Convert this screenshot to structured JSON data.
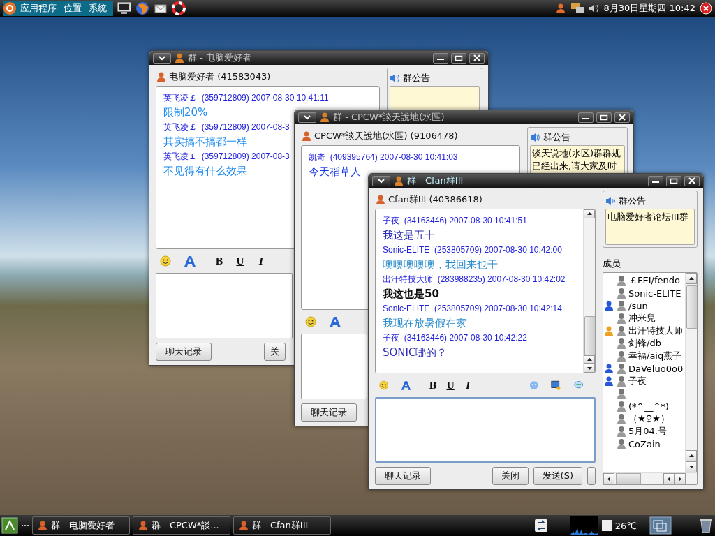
{
  "top_panel": {
    "menus": [
      {
        "label": "应用程序"
      },
      {
        "label": "位置"
      },
      {
        "label": "系统"
      }
    ],
    "clock": "8月30日星期四 10:42"
  },
  "windows": [
    {
      "title": "群 - 电脑爱好者",
      "active": false,
      "group": "电脑爱好者 (41583043)",
      "messages": [
        {
          "header": "英飞凌￡  (359712809) 2007-08-30 10:41:11",
          "text": "限制20%",
          "color": "#1e8cf0",
          "bold": false
        },
        {
          "header": "英飞凌￡  (359712809) 2007-08-3",
          "text": "其实搞不搞都一样",
          "color": "#1e8cf0",
          "bold": false
        },
        {
          "header": "英飞凌￡  (359712809) 2007-08-3",
          "text": "不见得有什么效果",
          "color": "#1e8cf0",
          "bold": false
        }
      ],
      "announcement": {
        "title": "群公告"
      },
      "format_buttons": [
        "B",
        "U",
        "I"
      ],
      "buttons": [
        "聊天记录",
        "关"
      ]
    },
    {
      "title": "群 - CPCW*談天說地(水區)",
      "active": false,
      "group": "CPCW*談天說地(水區) (9106478)",
      "messages": [
        {
          "header": "凯奇  (409395764) 2007-08-30 10:41:03",
          "text": "今天稻草人",
          "color": "#1a3ae8",
          "bold": false
        }
      ],
      "announcement": {
        "title": "群公告",
        "lines": [
          "谈天说地(水区)群群规",
          "已经出来,请大家及时"
        ]
      },
      "buttons": [
        "聊天记录"
      ]
    },
    {
      "title": "群 - Cfan群III",
      "active": true,
      "group": "Cfan群III (40386618)",
      "messages": [
        {
          "header": "子夜  (34163446) 2007-08-30 10:41:51",
          "text": "我这是五十",
          "color": "#2a2ab4",
          "bold": false
        },
        {
          "header": "Sonic-ELITE  (253805709) 2007-08-30 10:42:00",
          "text": "噢噢噢噢噢，我回来也干",
          "color": "#2a8ccc",
          "bold": false
        },
        {
          "header": "出汗特技大师  (283988235) 2007-08-30 10:42:02",
          "text": "我这也是50",
          "color": "#111111",
          "bold": true
        },
        {
          "header": "Sonic-ELITE  (253805709) 2007-08-30 10:42:14",
          "text": "我现在放暑假在家",
          "color": "#2a8ccc",
          "bold": false
        },
        {
          "header": "子夜  (34163446) 2007-08-30 10:42:22",
          "text": "SONIC哪的？",
          "color": "#2a2ab4",
          "bold": false
        }
      ],
      "announcement": {
        "title": "群公告",
        "lines": [
          "电脑爱好者论坛III群"
        ]
      },
      "format_buttons": [
        "B",
        "U",
        "I"
      ],
      "buttons": [
        "聊天记录",
        "关闭",
        "发送(S)"
      ],
      "members_label": "成员",
      "members": [
        {
          "name": "￡FEI/fendo",
          "admin": false
        },
        {
          "name": "Sonic-ELITE",
          "admin": false
        },
        {
          "name": "/sun",
          "admin": true,
          "color": "#2458d8"
        },
        {
          "name": "冲米兒",
          "admin": false
        },
        {
          "name": "出汗特技大师",
          "admin": true,
          "color": "#f0a020"
        },
        {
          "name": "剑锋/db",
          "admin": false
        },
        {
          "name": "幸福/aiq燕子",
          "admin": false
        },
        {
          "name": "DaVeluo0o0",
          "admin": true,
          "color": "#2458d8"
        },
        {
          "name": "子夜",
          "admin": true,
          "color": "#2458d8"
        },
        {
          "admin": false
        },
        {
          "name": "(*^__^*)",
          "admin": false
        },
        {
          "name": "（★♀★）",
          "admin": false
        },
        {
          "name": "5月04.号",
          "admin": false
        },
        {
          "name": "CoZain",
          "admin": false
        }
      ]
    }
  ],
  "taskbar": {
    "tasks": [
      {
        "label": "群 - 电脑爱好者"
      },
      {
        "label": "群 - CPCW*談..."
      },
      {
        "label": "群 - Cfan群III"
      }
    ],
    "temperature": "26℃"
  }
}
